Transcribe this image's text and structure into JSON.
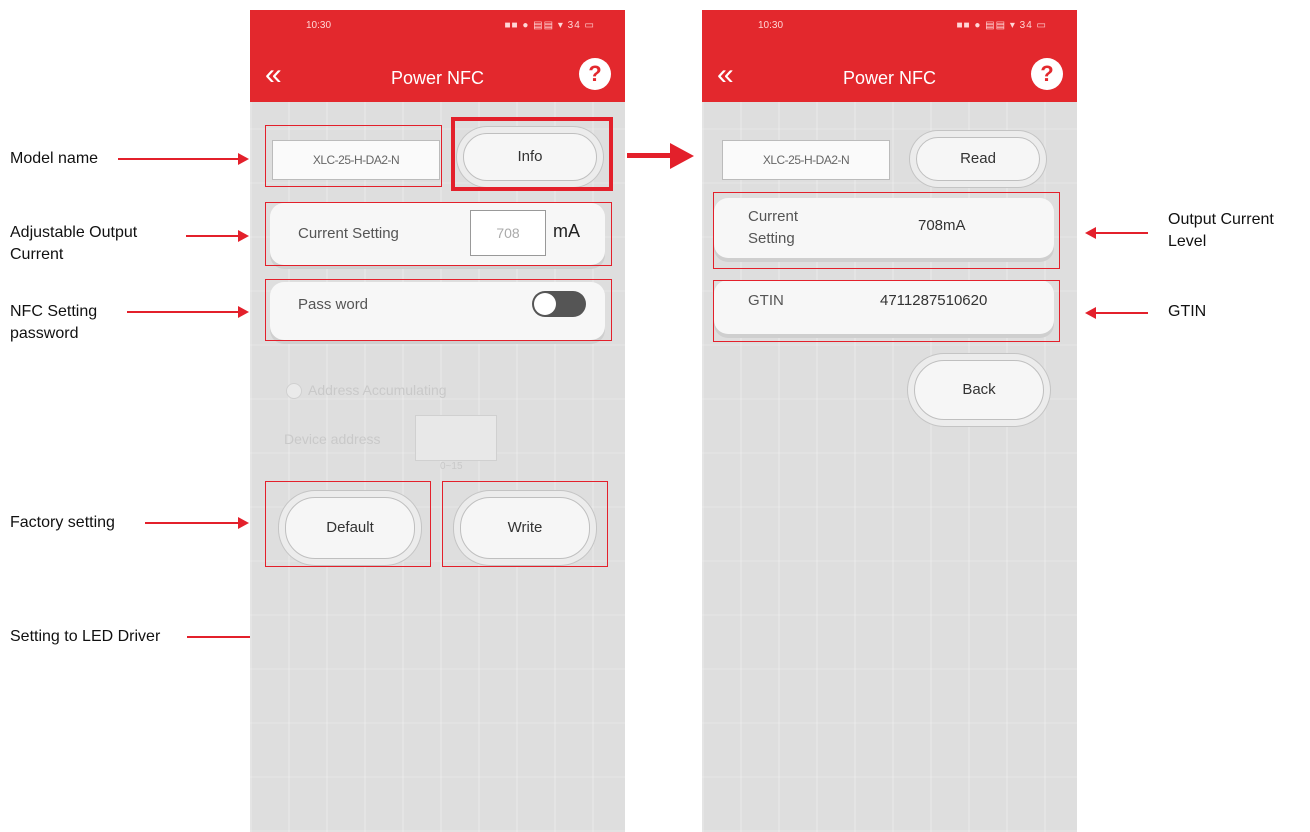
{
  "left_phone": {
    "status_time": "10:30",
    "status_icons": "■■ ● ▤▤ ▾ 34 ▭",
    "back_glyph": "«",
    "title": "Power NFC",
    "help_glyph": "?",
    "model_name_value": "XLC-25-H-DA2-N",
    "info_button": "Info",
    "current_label": "Current Setting",
    "current_value": "708",
    "current_unit": "mA",
    "password_label": "Pass word",
    "address_accumulating_label": "Address Accumulating",
    "device_address_label": "Device address",
    "device_address_range": "0~15",
    "default_button": "Default",
    "write_button": "Write"
  },
  "right_phone": {
    "status_time": "10:30",
    "status_icons": "■■ ● ▤▤ ▾ 34 ▭",
    "back_glyph": "«",
    "title": "Power NFC",
    "help_glyph": "?",
    "model_name_value": "XLC-25-H-DA2-N",
    "read_button": "Read",
    "current_label_line1": "Current",
    "current_label_line2": "Setting",
    "current_value": "708mA",
    "gtin_label": "GTIN",
    "gtin_value": "4711287510620",
    "back_button": "Back"
  },
  "annotations": {
    "model_name": "Model  name",
    "adjustable_output_line1": "Adjustable Output",
    "adjustable_output_line2": "Current",
    "nfc_setting_line1": "NFC Setting",
    "nfc_setting_line2": "password",
    "factory_setting": "Factory setting",
    "setting_to_led": "Setting to LED Driver",
    "output_current_line1": "Output Current",
    "output_current_line2": "Level",
    "gtin": "GTIN"
  },
  "colors": {
    "accent_red": "#e3282d",
    "annotation_red": "#e3202b"
  }
}
